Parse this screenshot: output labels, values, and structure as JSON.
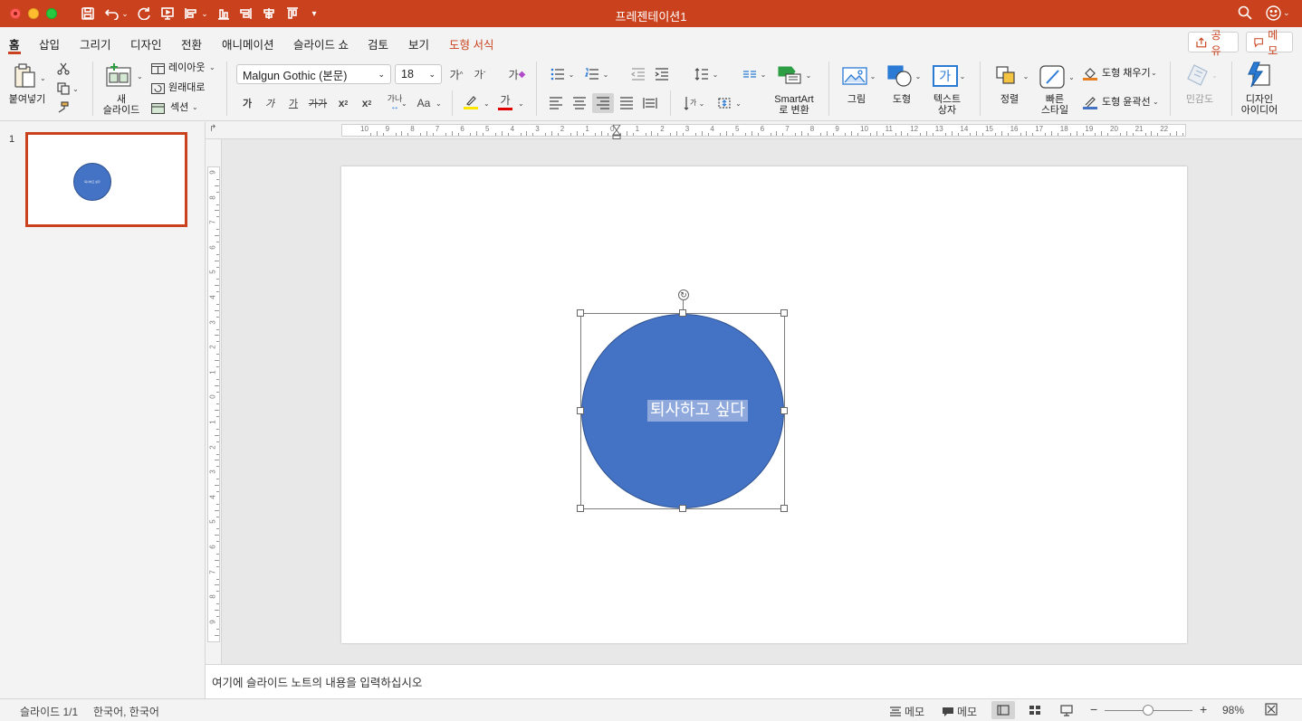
{
  "window": {
    "title": "프레젠테이션1"
  },
  "ribbon_tabs": [
    {
      "label": "홈",
      "active": true
    },
    {
      "label": "삽입"
    },
    {
      "label": "그리기"
    },
    {
      "label": "디자인"
    },
    {
      "label": "전환"
    },
    {
      "label": "애니메이션"
    },
    {
      "label": "슬라이드 쇼"
    },
    {
      "label": "검토"
    },
    {
      "label": "보기"
    },
    {
      "label": "도형 서식",
      "contextual": true
    }
  ],
  "header_buttons": {
    "share": "공유",
    "memo": "메모"
  },
  "ribbon": {
    "paste": "붙여넣기",
    "new_slide_l1": "새",
    "new_slide_l2": "슬라이드",
    "layout": "레이아웃",
    "reset": "원래대로",
    "section": "섹션",
    "font_name": "Malgun Gothic (본문)",
    "font_size": "18",
    "grow_font": "가",
    "shrink_font": "가",
    "clear_format": "가",
    "bold": "가",
    "italic": "가",
    "underline": "가",
    "strike": "가",
    "superscript": "x",
    "subscript": "x",
    "char_spacing": "가나",
    "change_case": "Aa",
    "font_color": "가",
    "smartart_l1": "SmartArt",
    "smartart_l2": "로 변환",
    "picture": "그림",
    "shapes": "도형",
    "textbox_l1": "텍스트",
    "textbox_l2": "상자",
    "arrange": "정렬",
    "quick_styles_l1": "빠른",
    "quick_styles_l2": "스타일",
    "shape_fill": "도형 채우기",
    "shape_outline": "도형 윤곽선",
    "sensitivity": "민감도",
    "design_ideas_l1": "디자인",
    "design_ideas_l2": "아이디어",
    "textbox_icon_char": "가"
  },
  "colors": {
    "accent": "#c9421d",
    "shape_fill": "#4472c4",
    "highlight": "#ffe600",
    "font_color": "#e00000",
    "fill_bar": "#e67e22",
    "outline_bar": "#4472c4"
  },
  "slides_panel": {
    "slide_number": "1",
    "thumb_text": "퇴사하고 싶다"
  },
  "rulers": {
    "horizontal": [
      "10",
      "9",
      "8",
      "7",
      "6",
      "5",
      "4",
      "3",
      "2",
      "1",
      "0",
      "1",
      "2",
      "3",
      "4",
      "5",
      "6",
      "7",
      "8",
      "9",
      "10",
      "11",
      "12",
      "13",
      "14",
      "15",
      "16",
      "17",
      "18",
      "19",
      "20",
      "21",
      "22"
    ],
    "vertical": [
      "9",
      "8",
      "7",
      "6",
      "5",
      "4",
      "3",
      "2",
      "1",
      "0",
      "1",
      "2",
      "3",
      "4",
      "5",
      "6",
      "7",
      "8",
      "9"
    ]
  },
  "slide": {
    "shape_text": "퇴사하고 싶다"
  },
  "notes": {
    "placeholder": "여기에 슬라이드 노트의 내용을 입력하십시오"
  },
  "status": {
    "slide_counter": "슬라이드 1/1",
    "language": "한국어, 한국어",
    "notes_btn": "메모",
    "comments_btn": "메모",
    "zoom": "98%",
    "zoom_minus": "−",
    "zoom_plus": "+"
  }
}
